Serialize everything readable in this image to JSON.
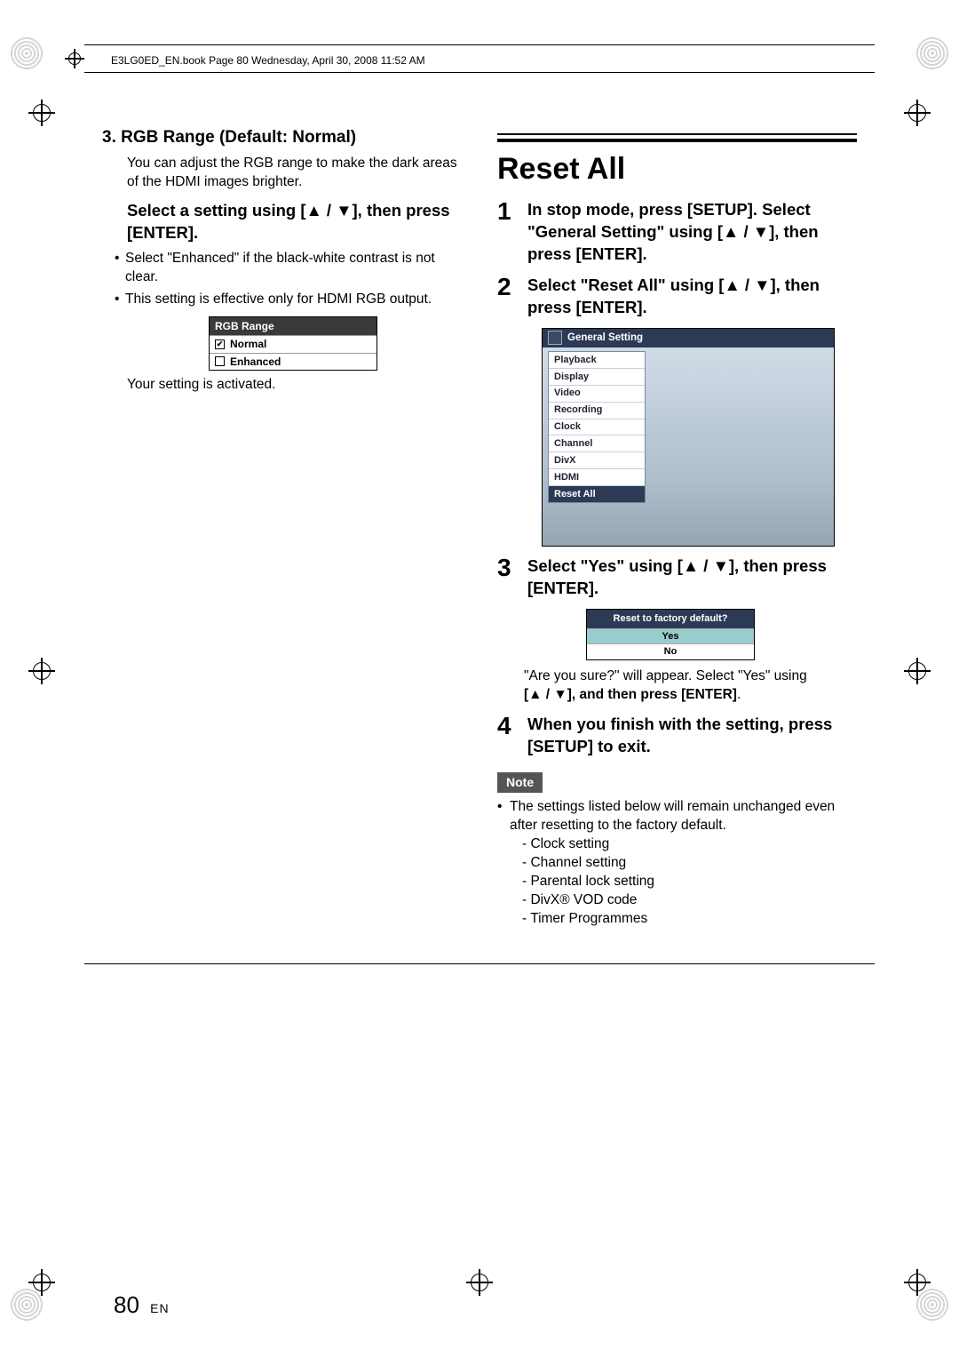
{
  "running_header": "E3LG0ED_EN.book  Page 80  Wednesday, April 30, 2008  11:52 AM",
  "left": {
    "section_title": "3.  RGB Range (Default: Normal)",
    "section_desc": "You can adjust the RGB range to make the dark areas of the HDMI images brighter.",
    "sub_title": "Select a setting using [▲ / ▼], then press [ENTER].",
    "bullets": [
      "Select \"Enhanced\" if the black-white contrast is not clear.",
      "This setting is effective only for HDMI RGB output."
    ],
    "osd": {
      "title": "RGB Range",
      "opt1": "Normal",
      "opt2": "Enhanced"
    },
    "after": "Your setting is activated."
  },
  "right": {
    "title": "Reset All",
    "steps": {
      "s1": "In stop mode, press [SETUP]. Select \"General Setting\" using [▲ / ▼], then press [ENTER].",
      "s2": "Select \"Reset All\" using [▲ / ▼], then press [ENTER].",
      "s3": "Select \"Yes\" using [▲ / ▼], then press [ENTER].",
      "s4": "When you finish with the setting, press [SETUP] to exit."
    },
    "menu": {
      "bar": "General Setting",
      "items": [
        "Playback",
        "Display",
        "Video",
        "Recording",
        "Clock",
        "Channel",
        "DivX",
        "HDMI",
        "Reset All"
      ]
    },
    "confirm": {
      "q": "Reset to factory default?",
      "yes": "Yes",
      "no": "No"
    },
    "confirm_after_1": "\"Are you sure?\" will appear. Select \"Yes\" using",
    "confirm_after_2": "[▲ / ▼], and then press ",
    "confirm_after_3": "[ENTER]",
    "confirm_after_4": ".",
    "note_label": "Note",
    "note_lead": "The settings listed below will remain unchanged even after resetting to the factory default.",
    "note_items": [
      "- Clock setting",
      "- Channel setting",
      "- Parental lock setting",
      "- DivX® VOD code",
      "- Timer Programmes"
    ]
  },
  "page": {
    "num": "80",
    "lang": "EN"
  }
}
